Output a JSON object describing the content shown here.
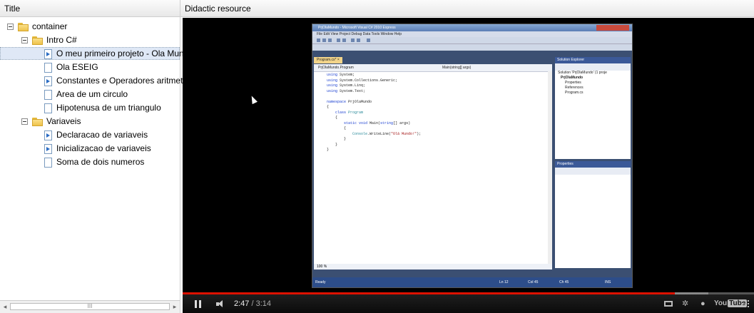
{
  "left_panel": {
    "header": "Title",
    "tree": [
      {
        "label": "container",
        "type": "folder",
        "toggle": true,
        "level": 0
      },
      {
        "label": "Intro C#",
        "type": "folder",
        "toggle": true,
        "level": 1
      },
      {
        "label": "O meu primeiro projeto - Ola Mundo",
        "type": "video",
        "selected": true,
        "level": 2
      },
      {
        "label": "Ola ESEIG",
        "type": "doc",
        "level": 2
      },
      {
        "label": "Constantes e Operadores aritmeticos",
        "type": "video",
        "level": 2
      },
      {
        "label": "Area de um circulo",
        "type": "doc",
        "level": 2
      },
      {
        "label": "Hipotenusa de um triangulo",
        "type": "doc",
        "level": 2
      },
      {
        "label": "Variaveis",
        "type": "folder",
        "toggle": true,
        "level": 1
      },
      {
        "label": "Declaracao de variaveis",
        "type": "video",
        "level": 2
      },
      {
        "label": "Inicializacao de variaveis",
        "type": "video",
        "level": 2
      },
      {
        "label": "Soma de dois numeros",
        "type": "doc",
        "level": 2
      }
    ],
    "scroll_left": "◂",
    "scroll_right": "▸",
    "scroll_grip": "III"
  },
  "right_panel": {
    "header": "Didactic resource"
  },
  "vs": {
    "title": "PrjOlaMundo - Microsoft Visual C# 2010 Express",
    "menu": "File  Edit  View  Project  Debug  Data  Tools  Window  Help",
    "tab": "Program.cs*  ×",
    "nav_left": "PrjOlaMundo.Program",
    "nav_right": "Main(string[] args)",
    "zoom": "100 %",
    "solution_header": "Solution Explorer",
    "solution_items": [
      "Solution 'PrjOlaMundo' (1 proje",
      "PrjOlaMundo",
      "Properties",
      "References",
      "Program.cs"
    ],
    "properties_header": "Properties",
    "status_ready": "Ready",
    "status_ln": "Ln 12",
    "status_col": "Col 45",
    "status_ch": "Ch 45",
    "status_ins": "INS"
  },
  "player": {
    "current_time": "2:47",
    "duration": "/ 3:14",
    "progress": 0.861,
    "logo": "You",
    "logo_tube": "Tube"
  },
  "colors": {
    "selected_row": "#dfe8f6",
    "progress_played": "#dd1100",
    "video_bg": "#000000"
  }
}
